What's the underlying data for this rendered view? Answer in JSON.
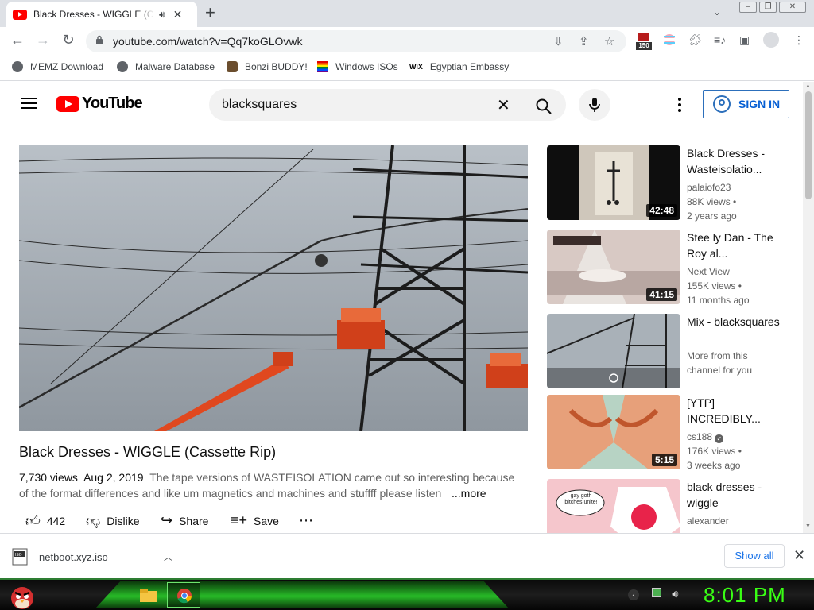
{
  "browser": {
    "tab_title": "Black Dresses - WIGGLE (Cassette Rip) - YouTube",
    "new_tab_label": "+",
    "url": "youtube.com/watch?v=Qq7koGLOvwk",
    "ext_badge": "150",
    "bookmarks": [
      {
        "label": "MEMZ Download"
      },
      {
        "label": "Malware Database"
      },
      {
        "label": "Bonzi BUDDY!"
      },
      {
        "label": "Windows ISOs"
      },
      {
        "label": "Egyptian Embassy"
      }
    ]
  },
  "youtube": {
    "logo_text": "YouTube",
    "search_query": "blacksquares",
    "sign_in": "SIGN IN",
    "video": {
      "title": "Black Dresses - WIGGLE (Cassette Rip)",
      "views": "7,730 views",
      "date": "Aug 2, 2019",
      "description": "The tape versions of WASTEISOLATION came out so interesting because of the format differences and like um magnetics and machines and stuffff please listen",
      "more": "...more",
      "likes": "442",
      "dislike": "Dislike",
      "share": "Share",
      "save": "Save"
    },
    "recommendations": [
      {
        "title": "Black Dresses - Wasteisolatio...",
        "channel": "palaiofo23",
        "views": "88K views •",
        "age": "2 years ago",
        "duration": "42:48"
      },
      {
        "title": "Stee ly Dan - The Roy al...",
        "channel": "Next View",
        "views": "155K views •",
        "age": "11 months ago",
        "duration": "41:15"
      },
      {
        "title": "Mix - blacksquares",
        "channel": "More from this",
        "views": "channel for you",
        "age": "",
        "duration": ""
      },
      {
        "title": "[YTP] INCREDIBLY...",
        "channel": "cs188",
        "views": "176K views •",
        "age": "3 weeks ago",
        "duration": "5:15"
      },
      {
        "title": "black dresses - wiggle",
        "channel": "alexander",
        "views": "",
        "age": "",
        "duration": "",
        "thumb_text": "gay goth bitches unite!"
      }
    ]
  },
  "downloads": {
    "filename": "netboot.xyz.iso",
    "show_all": "Show all"
  },
  "taskbar": {
    "clock": "8:01 PM"
  }
}
